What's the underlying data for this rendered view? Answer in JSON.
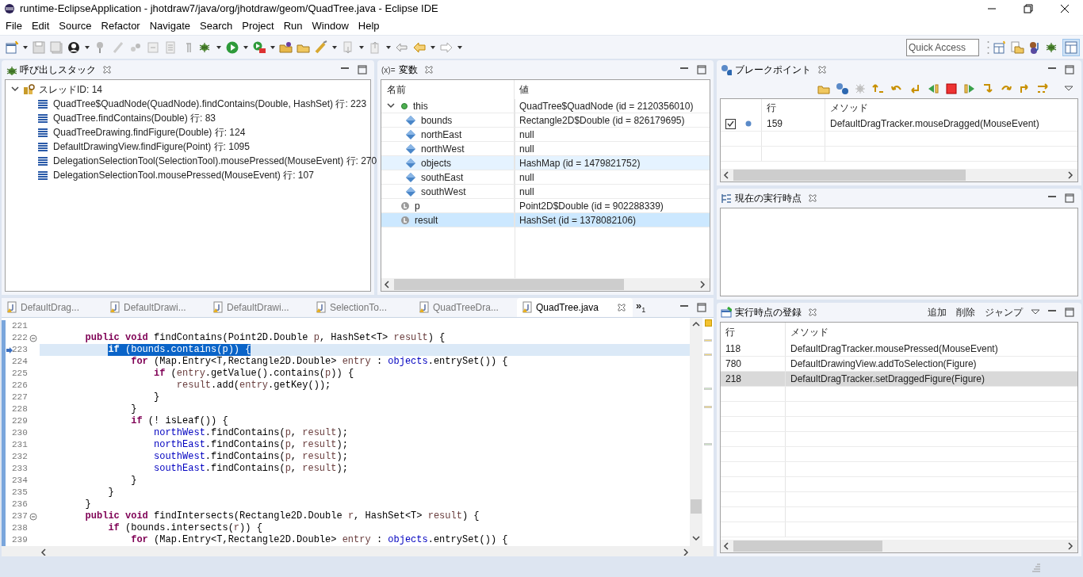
{
  "window": {
    "title": "runtime-EclipseApplication - jhotdraw7/java/org/jhotdraw/geom/QuadTree.java - Eclipse IDE"
  },
  "menu": [
    "File",
    "Edit",
    "Source",
    "Refactor",
    "Navigate",
    "Search",
    "Project",
    "Run",
    "Window",
    "Help"
  ],
  "quick_access": {
    "placeholder": "Quick Access"
  },
  "call_stack": {
    "title": "呼び出しスタック",
    "thread": {
      "label": "スレッドID: 14",
      "expanded": true,
      "children": [
        {
          "label": "QuadTree$QuadNode(QuadNode).findContains(Double, HashSet) 行: 223"
        },
        {
          "label": "QuadTree.findContains(Double) 行: 83"
        },
        {
          "label": "QuadTreeDrawing.findFigure(Double) 行: 124"
        },
        {
          "label": "DefaultDrawingView.findFigure(Point) 行: 1095"
        },
        {
          "label": "DelegationSelectionTool(SelectionTool).mousePressed(MouseEvent) 行: 270"
        },
        {
          "label": "DelegationSelectionTool.mousePressed(MouseEvent) 行: 107"
        }
      ]
    }
  },
  "variables": {
    "title": "変数",
    "icon_text": "(x)=",
    "columns": [
      "名前",
      "値"
    ],
    "rows": [
      {
        "kind": "object",
        "name": "this",
        "value": "QuadTree$QuadNode (id = 2120356010)",
        "expanded": true,
        "selected": false,
        "hover": false,
        "children": [
          {
            "kind": "field",
            "name": "bounds",
            "value": "Rectangle2D$Double (id = 826179695)",
            "selected": false,
            "hover": false
          },
          {
            "kind": "field",
            "name": "northEast",
            "value": "null",
            "selected": false,
            "hover": false
          },
          {
            "kind": "field",
            "name": "northWest",
            "value": "null",
            "selected": false,
            "hover": false
          },
          {
            "kind": "field",
            "name": "objects",
            "value": "HashMap (id = 1479821752)",
            "selected": false,
            "hover": true
          },
          {
            "kind": "field",
            "name": "southEast",
            "value": "null",
            "selected": false,
            "hover": false
          },
          {
            "kind": "field",
            "name": "southWest",
            "value": "null",
            "selected": false,
            "hover": false
          }
        ]
      },
      {
        "kind": "local",
        "name": "p",
        "value": "Point2D$Double (id = 902288339)",
        "selected": false,
        "hover": false
      },
      {
        "kind": "local",
        "name": "result",
        "value": "HashSet (id = 1378082106)",
        "selected": true,
        "hover": false
      }
    ]
  },
  "breakpoints": {
    "title": "ブレークポイント",
    "columns": [
      "行",
      "メソッド"
    ],
    "rows": [
      {
        "checked": true,
        "line": "159",
        "method": "DefaultDragTracker.mouseDragged(MouseEvent)"
      }
    ]
  },
  "current_point": {
    "title": "現在の実行時点"
  },
  "registrations": {
    "title": "実行時点の登録",
    "actions": [
      "追加",
      "削除",
      "ジャンプ"
    ],
    "columns": [
      "行",
      "メソッド"
    ],
    "rows": [
      {
        "line": "118",
        "method": "DefaultDragTracker.mousePressed(MouseEvent)",
        "selected": false
      },
      {
        "line": "780",
        "method": "DefaultDrawingView.addToSelection(Figure)",
        "selected": false
      },
      {
        "line": "218",
        "method": "DefaultDragTracker.setDraggedFigure(Figure)",
        "selected": true
      }
    ]
  },
  "editor": {
    "tabs": [
      {
        "label": "DefaultDrag...",
        "selected": false
      },
      {
        "label": "DefaultDrawi...",
        "selected": false
      },
      {
        "label": "DefaultDrawi...",
        "selected": false
      },
      {
        "label": "SelectionTo...",
        "selected": false
      },
      {
        "label": "QuadTreeDra...",
        "selected": false
      },
      {
        "label": "QuadTree.java",
        "selected": true
      }
    ],
    "overflow": {
      "glyph": "»",
      "count": "1"
    },
    "lines": [
      {
        "number": "221",
        "selected": false,
        "fold": false
      },
      {
        "number": "222",
        "selected": false,
        "fold": true,
        "tokens": [
          {
            "kind": "kw",
            "text": "public void"
          },
          {
            "kind": "plain",
            "text": " findContains(Point2D.Double "
          },
          {
            "kind": "local",
            "text": "p"
          },
          {
            "kind": "plain",
            "text": ", HashSet<T> "
          },
          {
            "kind": "local",
            "text": "result"
          },
          {
            "kind": "plain",
            "text": ") {"
          }
        ]
      },
      {
        "number": "223",
        "selected": true,
        "fold": false,
        "tokens": [
          {
            "kind": "kw",
            "text": "if"
          },
          {
            "kind": "plain",
            "text": " (bounds.contains("
          },
          {
            "kind": "local",
            "text": "p"
          },
          {
            "kind": "plain",
            "text": ")) {"
          }
        ]
      },
      {
        "number": "224",
        "selected": false,
        "fold": false,
        "tokens": [
          {
            "kind": "kw",
            "text": "for"
          },
          {
            "kind": "plain",
            "text": " (Map.Entry<T,Rectangle2D.Double> "
          },
          {
            "kind": "local",
            "text": "entry"
          },
          {
            "kind": "plain",
            "text": " : "
          },
          {
            "kind": "field",
            "text": "objects"
          },
          {
            "kind": "plain",
            "text": ".entrySet()) {"
          }
        ]
      },
      {
        "number": "225",
        "selected": false,
        "fold": false,
        "tokens": [
          {
            "kind": "kw",
            "text": "if"
          },
          {
            "kind": "plain",
            "text": " ("
          },
          {
            "kind": "local",
            "text": "entry"
          },
          {
            "kind": "plain",
            "text": ".getValue().contains("
          },
          {
            "kind": "local",
            "text": "p"
          },
          {
            "kind": "plain",
            "text": ")) {"
          }
        ]
      },
      {
        "number": "226",
        "selected": false,
        "fold": false,
        "tokens": [
          {
            "kind": "local",
            "text": "result"
          },
          {
            "kind": "plain",
            "text": ".add("
          },
          {
            "kind": "local",
            "text": "entry"
          },
          {
            "kind": "plain",
            "text": ".getKey());"
          }
        ]
      },
      {
        "number": "227",
        "selected": false,
        "fold": false,
        "tokens": [
          {
            "kind": "plain",
            "text": "}"
          }
        ]
      },
      {
        "number": "228",
        "selected": false,
        "fold": false,
        "tokens": [
          {
            "kind": "plain",
            "text": "}"
          }
        ]
      },
      {
        "number": "229",
        "selected": false,
        "fold": false,
        "tokens": [
          {
            "kind": "kw",
            "text": "if"
          },
          {
            "kind": "plain",
            "text": " (! isLeaf()) {"
          }
        ]
      },
      {
        "number": "230",
        "selected": false,
        "fold": false,
        "tokens": [
          {
            "kind": "field",
            "text": "northWest"
          },
          {
            "kind": "plain",
            "text": ".findContains("
          },
          {
            "kind": "local",
            "text": "p"
          },
          {
            "kind": "plain",
            "text": ", "
          },
          {
            "kind": "local",
            "text": "result"
          },
          {
            "kind": "plain",
            "text": ");"
          }
        ]
      },
      {
        "number": "231",
        "selected": false,
        "fold": false,
        "tokens": [
          {
            "kind": "field",
            "text": "northEast"
          },
          {
            "kind": "plain",
            "text": ".findContains("
          },
          {
            "kind": "local",
            "text": "p"
          },
          {
            "kind": "plain",
            "text": ", "
          },
          {
            "kind": "local",
            "text": "result"
          },
          {
            "kind": "plain",
            "text": ");"
          }
        ]
      },
      {
        "number": "232",
        "selected": false,
        "fold": false,
        "tokens": [
          {
            "kind": "field",
            "text": "southWest"
          },
          {
            "kind": "plain",
            "text": ".findContains("
          },
          {
            "kind": "local",
            "text": "p"
          },
          {
            "kind": "plain",
            "text": ", "
          },
          {
            "kind": "local",
            "text": "result"
          },
          {
            "kind": "plain",
            "text": ");"
          }
        ]
      },
      {
        "number": "233",
        "selected": false,
        "fold": false,
        "tokens": [
          {
            "kind": "field",
            "text": "southEast"
          },
          {
            "kind": "plain",
            "text": ".findContains("
          },
          {
            "kind": "local",
            "text": "p"
          },
          {
            "kind": "plain",
            "text": ", "
          },
          {
            "kind": "local",
            "text": "result"
          },
          {
            "kind": "plain",
            "text": ");"
          }
        ]
      },
      {
        "number": "234",
        "selected": false,
        "fold": false,
        "tokens": [
          {
            "kind": "plain",
            "text": "}"
          }
        ]
      },
      {
        "number": "235",
        "selected": false,
        "fold": false,
        "tokens": [
          {
            "kind": "plain",
            "text": "}"
          }
        ]
      },
      {
        "number": "236",
        "selected": false,
        "fold": false,
        "tokens": [
          {
            "kind": "plain",
            "text": "}"
          }
        ]
      },
      {
        "number": "237",
        "selected": false,
        "fold": true,
        "tokens": [
          {
            "kind": "kw",
            "text": "public void"
          },
          {
            "kind": "plain",
            "text": " findIntersects(Rectangle2D.Double "
          },
          {
            "kind": "local",
            "text": "r"
          },
          {
            "kind": "plain",
            "text": ", HashSet<T> "
          },
          {
            "kind": "local",
            "text": "result"
          },
          {
            "kind": "plain",
            "text": ") {"
          }
        ]
      },
      {
        "number": "238",
        "selected": false,
        "fold": false,
        "tokens": [
          {
            "kind": "kw",
            "text": "if"
          },
          {
            "kind": "plain",
            "text": " (bounds.intersects("
          },
          {
            "kind": "local",
            "text": "r"
          },
          {
            "kind": "plain",
            "text": ")) {"
          }
        ]
      },
      {
        "number": "239",
        "selected": false,
        "fold": false,
        "tokens": [
          {
            "kind": "kw",
            "text": "for"
          },
          {
            "kind": "plain",
            "text": " (Map.Entry<T,Rectangle2D.Double> "
          },
          {
            "kind": "local",
            "text": "entry"
          },
          {
            "kind": "plain",
            "text": " : "
          },
          {
            "kind": "field",
            "text": "objects"
          },
          {
            "kind": "plain",
            "text": ".entrySet()) {"
          }
        ]
      }
    ]
  }
}
